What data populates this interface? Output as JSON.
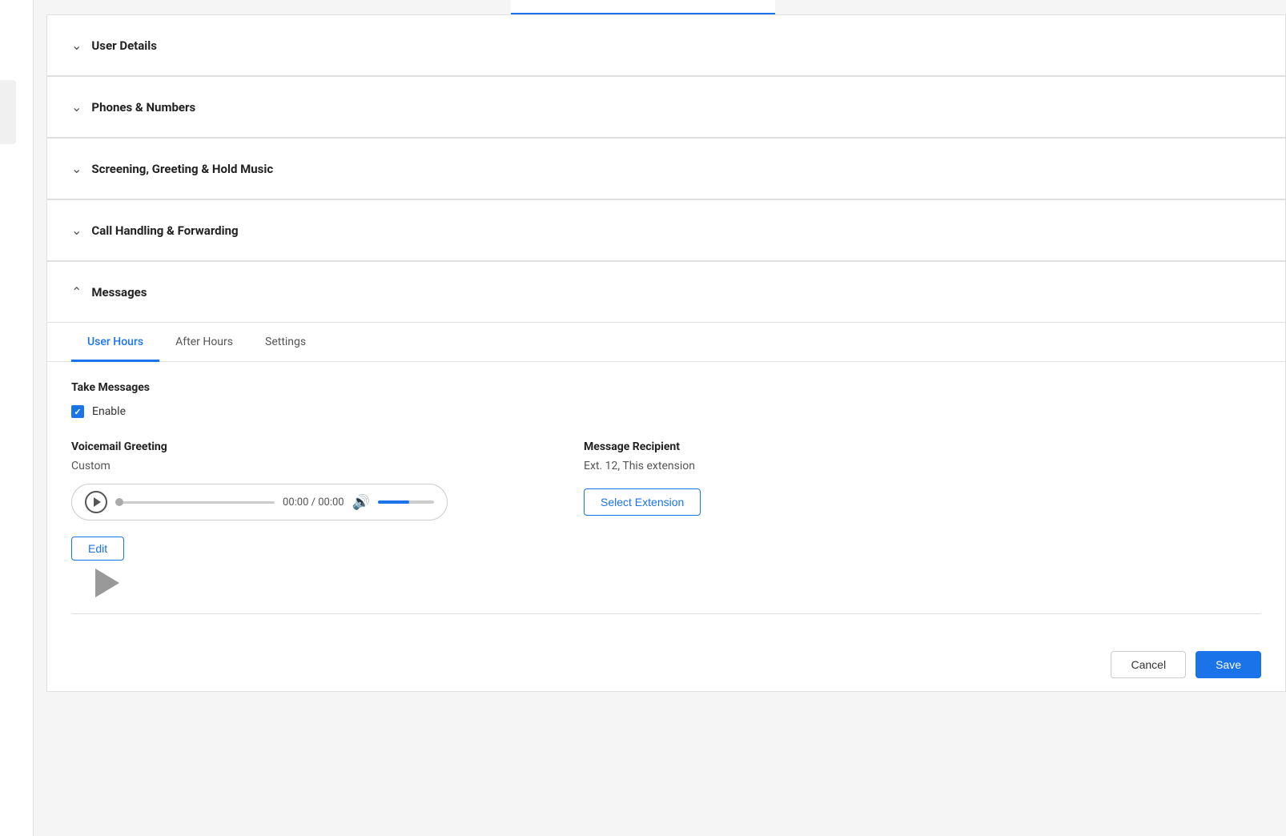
{
  "topBar": {
    "label": "top-bar"
  },
  "accordion": {
    "sections": [
      {
        "id": "user-details",
        "label": "User Details",
        "chevron": "chevron-down",
        "expanded": false
      },
      {
        "id": "phones-numbers",
        "label": "Phones & Numbers",
        "chevron": "chevron-down",
        "expanded": false
      },
      {
        "id": "screening-greeting",
        "label": "Screening, Greeting & Hold Music",
        "chevron": "chevron-down",
        "expanded": false
      },
      {
        "id": "call-handling",
        "label": "Call Handling & Forwarding",
        "chevron": "chevron-down",
        "expanded": false
      },
      {
        "id": "messages",
        "label": "Messages",
        "chevron": "chevron-up",
        "expanded": true
      }
    ]
  },
  "tabs": {
    "items": [
      {
        "id": "user-hours",
        "label": "User Hours",
        "active": true
      },
      {
        "id": "after-hours",
        "label": "After Hours",
        "active": false
      },
      {
        "id": "settings",
        "label": "Settings",
        "active": false
      }
    ]
  },
  "messagesSection": {
    "takeMessages": {
      "label": "Take Messages",
      "enable": {
        "checked": true,
        "label": "Enable"
      }
    },
    "voicemailGreeting": {
      "label": "Voicemail Greeting",
      "value": "Custom",
      "player": {
        "time": "00:00 / 00:00"
      },
      "editButton": "Edit"
    },
    "messageRecipient": {
      "label": "Message Recipient",
      "value": "Ext. 12, This extension",
      "selectButton": "Select Extension"
    }
  },
  "bottomButtons": {
    "cancel": "Cancel",
    "save": "Save"
  }
}
